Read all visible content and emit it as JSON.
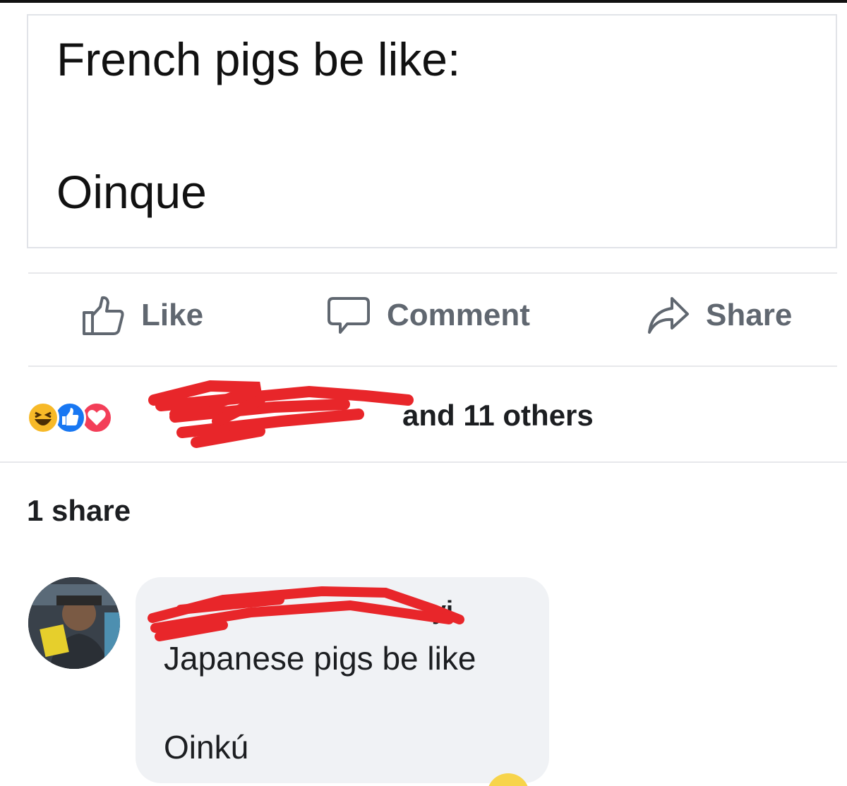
{
  "post": {
    "line1": "French pigs be like:",
    "line2": "Oinque"
  },
  "actions": {
    "like": {
      "label": "Like",
      "icon": "thumbs-up-icon"
    },
    "comment": {
      "label": "Comment",
      "icon": "comment-icon"
    },
    "share": {
      "label": "Share",
      "icon": "share-arrow-icon"
    }
  },
  "reactions": {
    "icons": [
      "haha-emoji-icon",
      "like-reaction-icon",
      "love-reaction-icon"
    ],
    "names_suffix": "and 11 others"
  },
  "shares_count": "1 share",
  "comment": {
    "author_visible_tail": "yi",
    "line1": "Japanese pigs be like",
    "line2": "Oinkú"
  },
  "colors": {
    "action_gray": "#606770",
    "like_blue": "#1877f2",
    "love_red": "#f33e58",
    "haha_yellow": "#f7b928",
    "redaction_red": "#e8262a",
    "bubble_bg": "#f0f2f5"
  }
}
